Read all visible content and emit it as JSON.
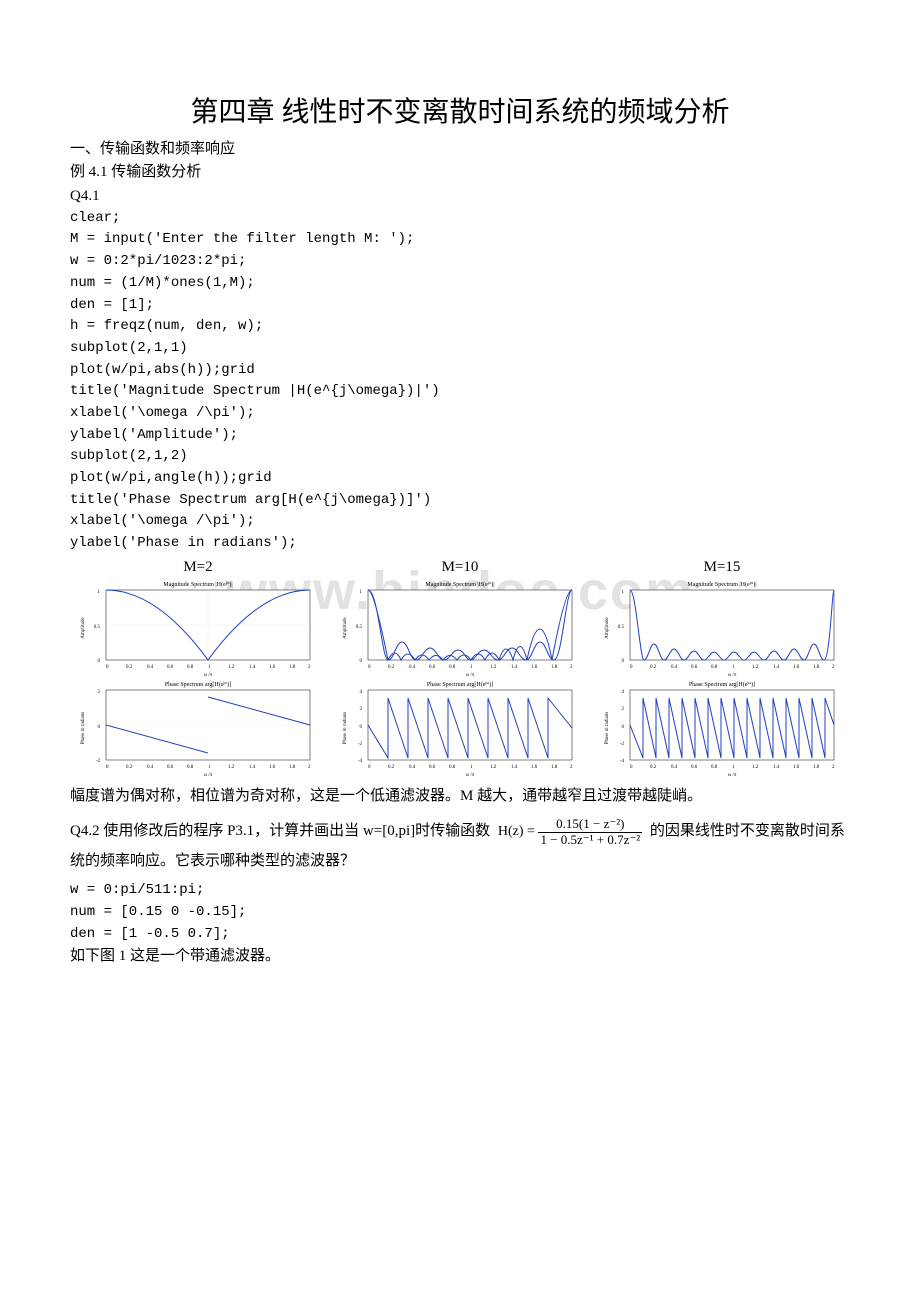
{
  "title": "第四章 线性时不变离散时间系统的频域分析",
  "section1_heading": "一、传输函数和频率响应",
  "example_heading": "例 4.1 传输函数分析",
  "q41_label": "Q4.1",
  "code1": [
    "clear;",
    "M = input('Enter the filter length M: ');",
    "w = 0:2*pi/1023:2*pi;",
    "num = (1/M)*ones(1,M);",
    "den = [1];",
    "h = freqz(num, den, w);",
    "subplot(2,1,1)",
    "plot(w/pi,abs(h));grid",
    "title('Magnitude Spectrum |H(e^{j\\omega})|')",
    "xlabel('\\omega /\\pi');",
    "ylabel('Amplitude');",
    "subplot(2,1,2)",
    "plot(w/pi,angle(h));grid",
    "title('Phase Spectrum arg[H(e^{j\\omega})]')",
    "xlabel('\\omega /\\pi');",
    "ylabel('Phase in radians');"
  ],
  "chart_labels": [
    "M=2",
    "M=10",
    "M=15"
  ],
  "chart_data": [
    {
      "type": "line",
      "title": "Magnitude Spectrum |H(e^{jω})|",
      "xlabel": "ω /π",
      "ylabel": "Amplitude",
      "xlim": [
        0,
        2
      ],
      "ylim": [
        0,
        1
      ],
      "xticks": [
        0,
        0.2,
        0.4,
        0.6,
        0.8,
        1,
        1.2,
        1.4,
        1.6,
        1.8,
        2
      ],
      "series": [
        {
          "name": "M=2",
          "x": [
            0,
            0.5,
            1,
            1.5,
            2
          ],
          "y": [
            1,
            0.707,
            0,
            0.707,
            1
          ]
        }
      ]
    },
    {
      "type": "line",
      "title": "Phase Spectrum arg[H(e^{jω})]",
      "xlabel": "ω /π",
      "ylabel": "Phase in radians",
      "xlim": [
        0,
        2
      ],
      "ylim": [
        -2,
        2
      ],
      "xticks": [
        0,
        0.2,
        0.4,
        0.6,
        0.8,
        1,
        1.2,
        1.4,
        1.6,
        1.8,
        2
      ],
      "series": [
        {
          "name": "M=2",
          "x": [
            0,
            1,
            1,
            2
          ],
          "y": [
            0,
            -1.57,
            1.57,
            0
          ]
        }
      ]
    },
    {
      "type": "line",
      "title": "Magnitude Spectrum |H(e^{jω})|",
      "xlabel": "ω /π",
      "ylabel": "Amplitude",
      "xlim": [
        0,
        2
      ],
      "ylim": [
        0,
        1
      ],
      "series": [
        {
          "name": "M=10",
          "note": "sinc-like with 9 nulls between 0 and 2"
        }
      ]
    },
    {
      "type": "line",
      "title": "Phase Spectrum arg[H(e^{jω})]",
      "xlabel": "ω /π",
      "ylabel": "Phase in radians",
      "xlim": [
        0,
        2
      ],
      "ylim": [
        -4,
        4
      ],
      "series": [
        {
          "name": "M=10",
          "note": "sawtooth wrapped phase"
        }
      ]
    },
    {
      "type": "line",
      "title": "Magnitude Spectrum |H(e^{jω})|",
      "xlabel": "ω /π",
      "ylabel": "Amplitude",
      "xlim": [
        0,
        2
      ],
      "ylim": [
        0,
        1
      ],
      "series": [
        {
          "name": "M=15",
          "note": "sinc-like with ~14 nulls"
        }
      ]
    },
    {
      "type": "line",
      "title": "Phase Spectrum arg[H(e^{jω})]",
      "xlabel": "ω /π",
      "ylabel": "Phase in radians",
      "xlim": [
        0,
        2
      ],
      "ylim": [
        -4,
        4
      ],
      "series": [
        {
          "name": "M=15",
          "note": "sawtooth wrapped phase, denser"
        }
      ]
    }
  ],
  "conclusion1": "幅度谱为偶对称，相位谱为奇对称，这是一个低通滤波器。M 越大，通带越窄且过渡带越陡峭。",
  "q42_prefix": "Q4.2 使用修改后的程序 P3.1，计算并画出当 w=[0,pi]时传输函数 ",
  "q42_eq_lhs": "H(z) = ",
  "q42_eq_num": "0.15(1 − z⁻²)",
  "q42_eq_den": "1 − 0.5z⁻¹ + 0.7z⁻²",
  "q42_suffix": " 的因果线性时不变离散时间系统的频率响应。它表示哪种类型的滤波器？",
  "code2": [
    "w = 0:pi/511:pi;",
    "num = [0.15 0 -0.15];",
    "den = [1 -0.5 0.7];"
  ],
  "conclusion2": "如下图 1 这是一个带通滤波器。"
}
